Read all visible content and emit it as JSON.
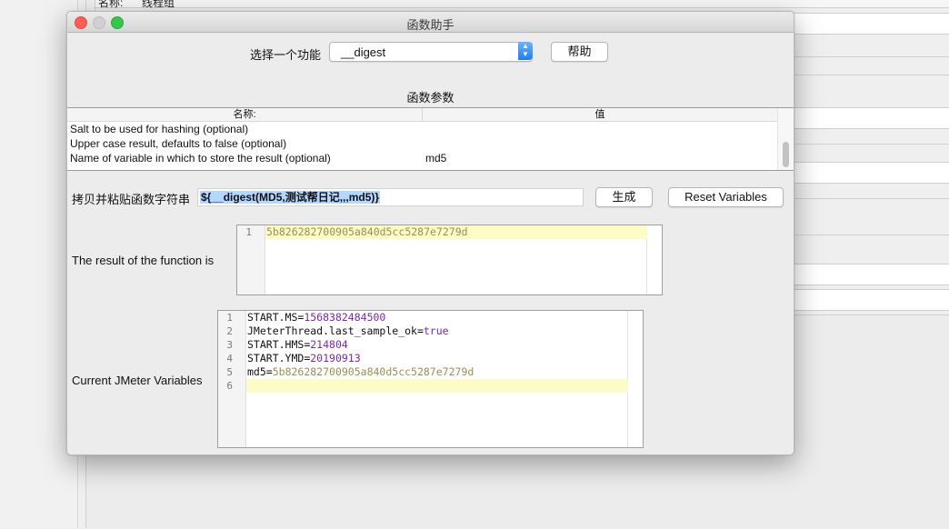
{
  "background": {
    "name_label": "名称:",
    "name_value": "线程组"
  },
  "dialog": {
    "title": "函数助手",
    "function_label": "选择一个功能",
    "function_selected": "__digest",
    "help_button": "帮助",
    "params_title": "函数参数",
    "table": {
      "col_name": "名称:",
      "col_value": "值",
      "rows": [
        {
          "name": "Salt to be used for hashing (optional)",
          "value": ""
        },
        {
          "name": "Upper case result, defaults to false (optional)",
          "value": ""
        },
        {
          "name": "Name of variable in which to store the result (optional)",
          "value": "md5"
        }
      ]
    },
    "copy_label": "拷贝并粘贴函数字符串",
    "copy_value": "${__digest(MD5,测试帮日记,,,md5)}",
    "generate_button": "生成",
    "reset_button": "Reset Variables",
    "result_label": "The result of the function is",
    "result_lines": [
      "5b826282700905a840d5cc5287e7279d"
    ],
    "vars_label": "Current JMeter Variables",
    "variables": [
      {
        "key": "START.MS",
        "value": "1568382484500",
        "kind": "num"
      },
      {
        "key": "JMeterThread.last_sample_ok",
        "value": "true",
        "kind": "num"
      },
      {
        "key": "START.HMS",
        "value": "214804",
        "kind": "num"
      },
      {
        "key": "START.YMD",
        "value": "20190913",
        "kind": "num"
      },
      {
        "key": "md5",
        "value": "5b826282700905a840d5cc5287e7279d",
        "kind": "str"
      },
      {
        "key": "",
        "value": "",
        "kind": "empty"
      }
    ]
  }
}
